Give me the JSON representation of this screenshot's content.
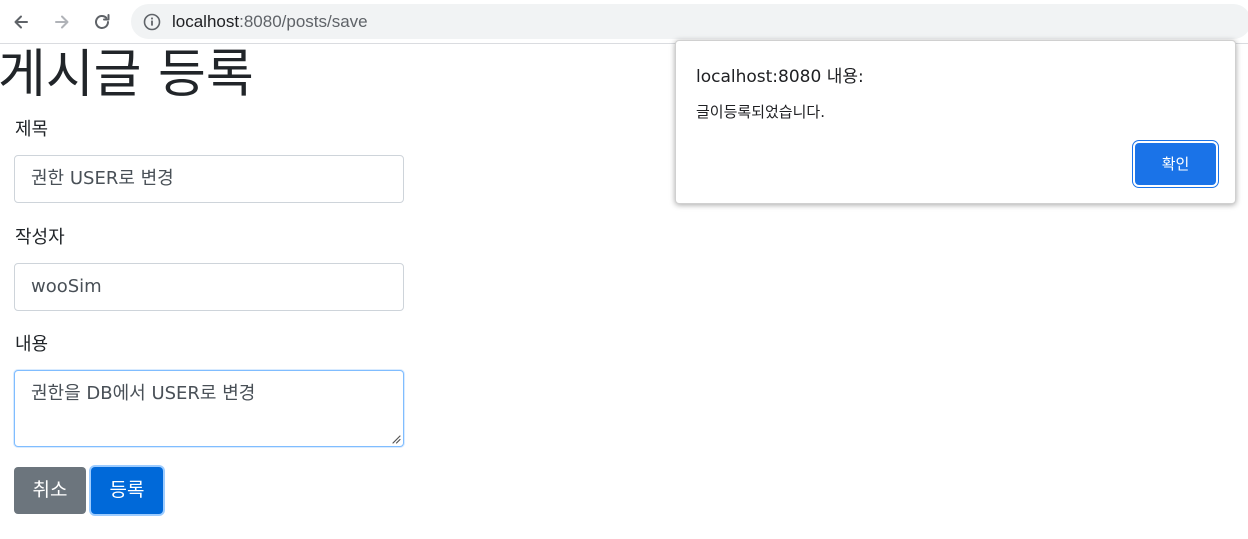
{
  "browser": {
    "url_host": "localhost",
    "url_rest": ":8080/posts/save"
  },
  "page": {
    "title": "게시글 등록",
    "form": {
      "title_label": "제목",
      "title_value": "권한 USER로 변경",
      "author_label": "작성자",
      "author_value": "wooSim",
      "content_label": "내용",
      "content_value": "권한을 DB에서 USER로 변경"
    },
    "buttons": {
      "cancel_label": "취소",
      "submit_label": "등록"
    }
  },
  "dialog": {
    "title": "localhost:8080 내용:",
    "message": "글이등록되었습니다.",
    "ok_label": "확인"
  },
  "colors": {
    "primary": "#0069d9",
    "secondary": "#6c757d",
    "dialog_button": "#1a73e8"
  },
  "icons": [
    "back-arrow-icon",
    "forward-arrow-icon",
    "reload-icon",
    "info-icon",
    "resize-handle-icon"
  ]
}
